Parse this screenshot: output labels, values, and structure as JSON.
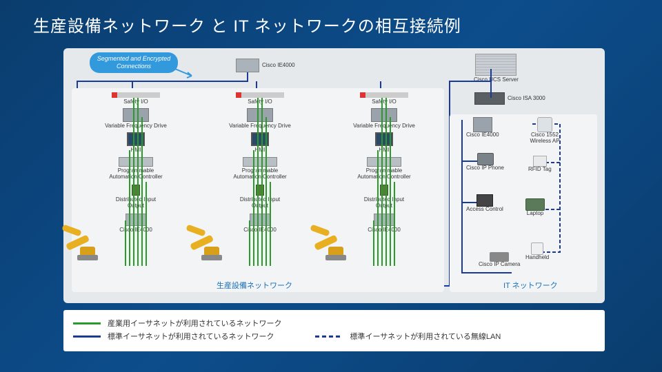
{
  "title": "生産設備ネットワーク と IT ネットワークの相互接続例",
  "callout": "Segmented and Encrypted Connections",
  "top_switch": "Cisco IE4000",
  "ucs": "Cisco UCS Server",
  "isa": "Cisco ISA 3000",
  "zones": {
    "production": "生産設備ネットワーク",
    "it": "IT ネットワーク"
  },
  "cell": {
    "safety": "Safety I/O",
    "vfd": "Variable Frequency Drive",
    "hmi": "HMI",
    "pac": "Programmable Automation Controller",
    "dio": "Distributed Input Output",
    "switch": "Cisco IE4000"
  },
  "it": {
    "ie": "Cisco IE4000",
    "phone": "Cisco IP Phone",
    "access": "Access Control",
    "camera": "Cisco IP Camera",
    "ap": "Cisco 1552 Wireless AP",
    "rfid": "RFID Tag",
    "laptop": "Laptop",
    "handheld": "Handheld"
  },
  "legend": {
    "industrial": "産業用イーサネットが利用されているネットワーク",
    "standard": "標準イーサネットが利用されているネットワーク",
    "wireless": "標準イーサネットが利用されている無線LAN"
  }
}
